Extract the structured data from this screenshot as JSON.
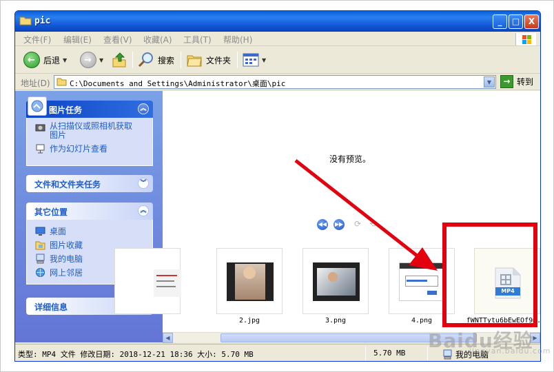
{
  "window": {
    "title": "pic",
    "min": "_",
    "max": "□",
    "close": "X"
  },
  "menu": [
    "文件(F)",
    "编辑(E)",
    "查看(V)",
    "收藏(A)",
    "工具(T)",
    "帮助(H)"
  ],
  "toolbar": {
    "back": "后退",
    "search": "搜索",
    "folders": "文件夹"
  },
  "address": {
    "label": "地址(D)",
    "path": "C:\\Documents and Settings\\Administrator\\桌面\\pic",
    "go": "转到"
  },
  "tasks": {
    "picture_tasks": {
      "title": "图片任务",
      "items": [
        "从扫描仪或照相机获取图片",
        "作为幻灯片查看"
      ]
    },
    "file_tasks": {
      "title": "文件和文件夹任务"
    },
    "other_places": {
      "title": "其它位置",
      "items": [
        "桌面",
        "图片收藏",
        "我的电脑",
        "网上邻居"
      ]
    },
    "details": {
      "title": "详细信息"
    }
  },
  "preview": {
    "message": "没有预览。"
  },
  "files": [
    {
      "name": "2.jpg"
    },
    {
      "name": "3.png"
    },
    {
      "name": "4.png"
    },
    {
      "name": "fWNTTytu6bEwEOf9m...",
      "badge": "MP4"
    }
  ],
  "status": {
    "info": "类型: MP4 文件 修改日期: 2018-12-21 18:36 大小: 5.70 MB",
    "size": "5.70 MB",
    "location": "我的电脑"
  },
  "watermark": {
    "brand": "Baidu经验",
    "url": "jingyan.baidu.com"
  },
  "colors": {
    "annotation": "#e3000f",
    "titlebar": "#0a5fd8",
    "taskpane": "#6375d6",
    "link": "#215dc6"
  }
}
